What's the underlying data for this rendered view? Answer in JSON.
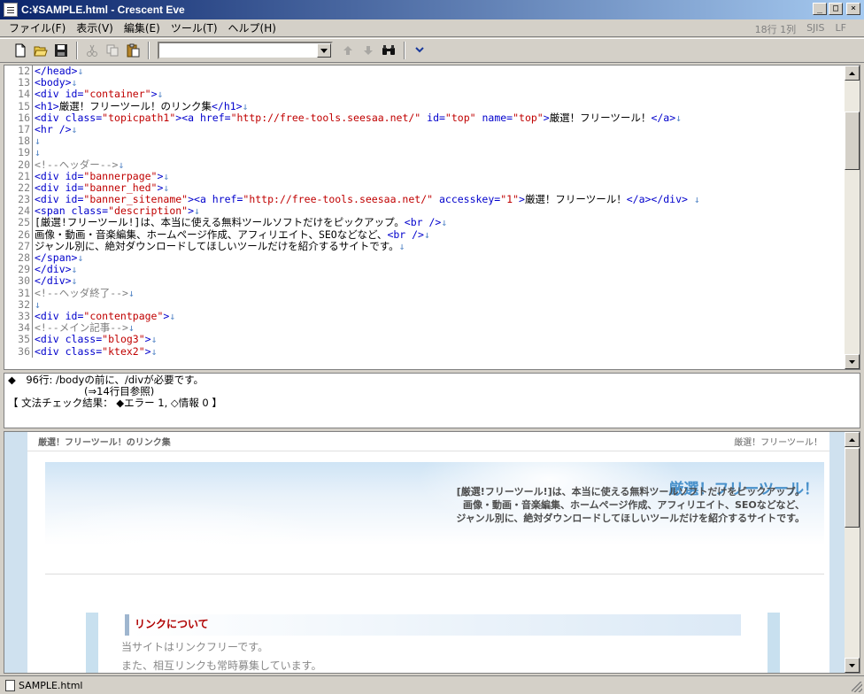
{
  "window": {
    "title": "C:¥SAMPLE.html - Crescent Eve"
  },
  "menu": [
    "ファイル(F)",
    "表示(V)",
    "編集(E)",
    "ツール(T)",
    "ヘルプ(H)"
  ],
  "status_right": {
    "position": "18行 1列",
    "encoding": "SJIS",
    "newline": "LF"
  },
  "toolbar": {
    "search_value": ""
  },
  "editor": {
    "lines": [
      {
        "n": "12",
        "html": "<span class='tag'>&lt;/head&gt;</span><span class='nl'>↓</span>"
      },
      {
        "n": "13",
        "html": "<span class='tag'>&lt;body&gt;</span><span class='nl'>↓</span>"
      },
      {
        "n": "14",
        "html": "<span class='tag'>&lt;div id=</span><span class='str'>\"container\"</span><span class='tag'>&gt;</span><span class='nl'>↓</span>"
      },
      {
        "n": "15",
        "html": "<span class='tag'>&lt;h1&gt;</span><span class='plain'>厳選！フリーツール！のリンク集</span><span class='tag'>&lt;/h1&gt;</span><span class='nl'>↓</span>"
      },
      {
        "n": "16",
        "html": "<span class='tag'>&lt;div class=</span><span class='str'>\"topicpath1\"</span><span class='tag'>&gt;&lt;a href=</span><span class='str'>\"http://free-tools.seesaa.net/\"</span><span class='tag'> id=</span><span class='str'>\"top\"</span><span class='tag'> name=</span><span class='str'>\"top\"</span><span class='tag'>&gt;</span><span class='plain'>厳選！フリーツール！</span><span class='tag'>&lt;/a&gt;</span><span class='nl'>↓</span>"
      },
      {
        "n": "17",
        "html": "<span class='tag'>&lt;hr /&gt;</span><span class='nl'>↓</span>"
      },
      {
        "n": "18",
        "html": "<span class='nl'>↓</span>"
      },
      {
        "n": "19",
        "html": "<span class='nl'>↓</span>"
      },
      {
        "n": "20",
        "html": "<span class='comment'>&lt;!--ヘッダー--&gt;</span><span class='nl'>↓</span>"
      },
      {
        "n": "21",
        "html": "<span class='tag'>&lt;div id=</span><span class='str'>\"bannerpage\"</span><span class='tag'>&gt;</span><span class='nl'>↓</span>"
      },
      {
        "n": "22",
        "html": "<span class='tag'>&lt;div id=</span><span class='str'>\"banner_hed\"</span><span class='tag'>&gt;</span><span class='nl'>↓</span>"
      },
      {
        "n": "23",
        "html": "<span class='tag'>&lt;div id=</span><span class='str'>\"banner_sitename\"</span><span class='tag'>&gt;&lt;a href=</span><span class='str'>\"http://free-tools.seesaa.net/\"</span><span class='tag'> accesskey=</span><span class='str'>\"1\"</span><span class='tag'>&gt;</span><span class='plain'>厳選！フリーツール！</span><span class='tag'>&lt;/a&gt;&lt;/div&gt;</span> <span class='nl'>↓</span>"
      },
      {
        "n": "24",
        "html": "<span class='tag'>&lt;span class=</span><span class='str'>\"description\"</span><span class='tag'>&gt;</span><span class='nl'>↓</span>"
      },
      {
        "n": "25",
        "html": "<span class='plain'>[厳選!フリーツール!]は、本当に使える無料ツールソフトだけをピックアップ。</span><span class='tag'>&lt;br /&gt;</span><span class='nl'>↓</span>"
      },
      {
        "n": "26",
        "html": "<span class='plain'>画像・動画・音楽編集、ホームページ作成、アフィリエイト、SEOなどなど、</span><span class='tag'>&lt;br /&gt;</span><span class='nl'>↓</span>"
      },
      {
        "n": "27",
        "html": "<span class='plain'>ジャンル別に、絶対ダウンロードしてほしいツールだけを紹介するサイトです。</span><span class='nl'>↓</span>"
      },
      {
        "n": "28",
        "html": "<span class='tag'>&lt;/span&gt;</span><span class='nl'>↓</span>"
      },
      {
        "n": "29",
        "html": "<span class='tag'>&lt;/div&gt;</span><span class='nl'>↓</span>"
      },
      {
        "n": "30",
        "html": "<span class='tag'>&lt;/div&gt;</span><span class='nl'>↓</span>"
      },
      {
        "n": "31",
        "html": "<span class='comment'>&lt;!--ヘッダ終了--&gt;</span><span class='nl'>↓</span>"
      },
      {
        "n": "32",
        "html": "<span class='nl'>↓</span>"
      },
      {
        "n": "33",
        "html": "<span class='tag'>&lt;div id=</span><span class='str'>\"contentpage\"</span><span class='tag'>&gt;</span><span class='nl'>↓</span>"
      },
      {
        "n": "34",
        "html": "<span class='comment'>&lt;!--メイン記事--&gt;</span><span class='nl'>↓</span>"
      },
      {
        "n": "35",
        "html": "<span class='tag'>&lt;div class=</span><span class='str'>\"blog3\"</span><span class='tag'>&gt;</span><span class='nl'>↓</span>"
      },
      {
        "n": "36",
        "html": "<span class='tag'>&lt;div class=</span><span class='str'>\"ktex2\"</span><span class='tag'>&gt;</span><span class='nl'>↓</span>"
      }
    ]
  },
  "messages": {
    "line1": "◆　96行: /bodyの前に、/divが必要です。",
    "line2": "(⇒14行目参照)",
    "line3": "【 文法チェック結果： ◆エラー 1, ◇情報 0 】"
  },
  "preview": {
    "h1": "厳選！フリーツール！のリンク集",
    "topicpath": "厳選！フリーツール！",
    "site_name": "厳選！フリーツール！",
    "desc1": "[厳選!フリーツール!]は、本当に使える無料ツールソフトだけをピックアップ。",
    "desc2": "画像・動画・音楽編集、ホームページ作成、アフィリエイト、SEOなどなど、",
    "desc3": "ジャンル別に、絶対ダウンロードしてほしいツールだけを紹介するサイトです。",
    "link_heading": "リンクについて",
    "para1": "当サイトはリンクフリーです。",
    "para2": "また、相互リンクも常時募集しています。"
  },
  "statusbar": {
    "filename": "SAMPLE.html"
  },
  "colors": {
    "title_bar": "#0a246a",
    "tag": "#0000cc",
    "string": "#c00000",
    "comment": "#808080"
  }
}
